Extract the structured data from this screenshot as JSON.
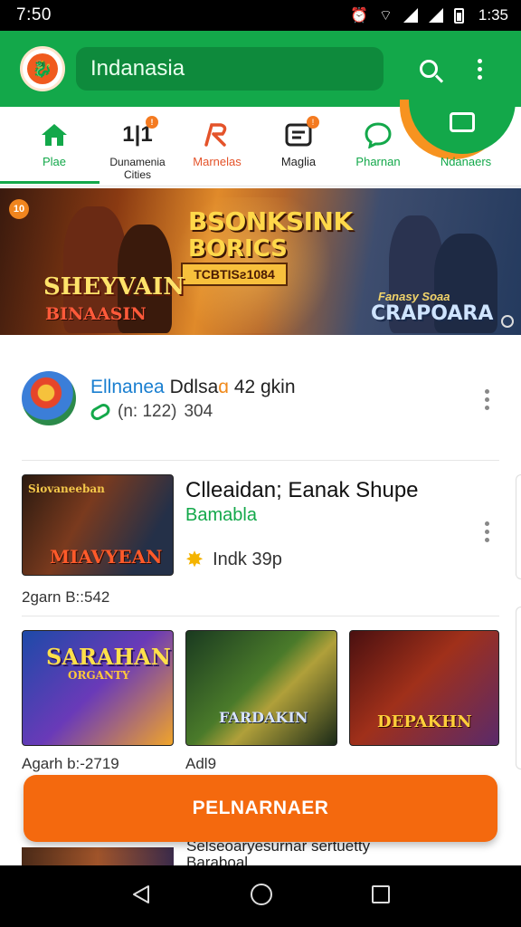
{
  "status_bar": {
    "time": "7:50",
    "clock_right": "1:35"
  },
  "app_bar": {
    "search_text": "Indanasia"
  },
  "tabs": [
    {
      "label": "Plae",
      "icon": "home-icon",
      "color": "#13a84a"
    },
    {
      "label": "Dunamenia\nCities",
      "icon": "chart-icon",
      "color": "#222222"
    },
    {
      "label": "Marnelas",
      "icon": "brush-icon",
      "color": "#e4532a"
    },
    {
      "label": "Maglia",
      "icon": "screen-icon",
      "color": "#222222"
    },
    {
      "label": "Pharnan",
      "icon": "chat-icon",
      "color": "#13a84a"
    },
    {
      "label": "Ndanaers",
      "icon": "bag-icon",
      "color": "#13a84a"
    }
  ],
  "banner": {
    "badge": "10",
    "title_line1": "BSONKSINK",
    "title_line2": "BORICS",
    "tag": "TCBTISƨ1084",
    "left_line1": "SHEYVAIN",
    "left_line2": "BINAASIN",
    "right_line1": "Fanasy Soaa",
    "right_line2": "CRAPOARA"
  },
  "row1": {
    "name_part1": "Ellnanea",
    "name_part2": "Ddlsa",
    "name_part3": "ɑ",
    "name_part4": "42 gkin",
    "meta_paren": "(n: 122)",
    "meta_num": "304"
  },
  "row2": {
    "title": "Clleaidan; Eanak Shupe",
    "subtitle": "Bamabla",
    "rating": "Indk 39p",
    "caption": "2garn B::542",
    "thumb_text": "MIAVYEAN",
    "thumb_top": "Siovaneeban"
  },
  "row3": {
    "cards": [
      {
        "text": "SARAHAN",
        "sub": "ORGANTY"
      },
      {
        "text": "FARDAKIN",
        "sub": ""
      },
      {
        "text": "DEPAKHN",
        "sub": ""
      }
    ],
    "caption1": "Agarh b:-2719",
    "caption2": "Adl9"
  },
  "bottom_peek": {
    "line1": "Selseoaryesurnar sertuetty",
    "line2": "Baraboal"
  },
  "cta": {
    "label": "PELNARNAER"
  }
}
